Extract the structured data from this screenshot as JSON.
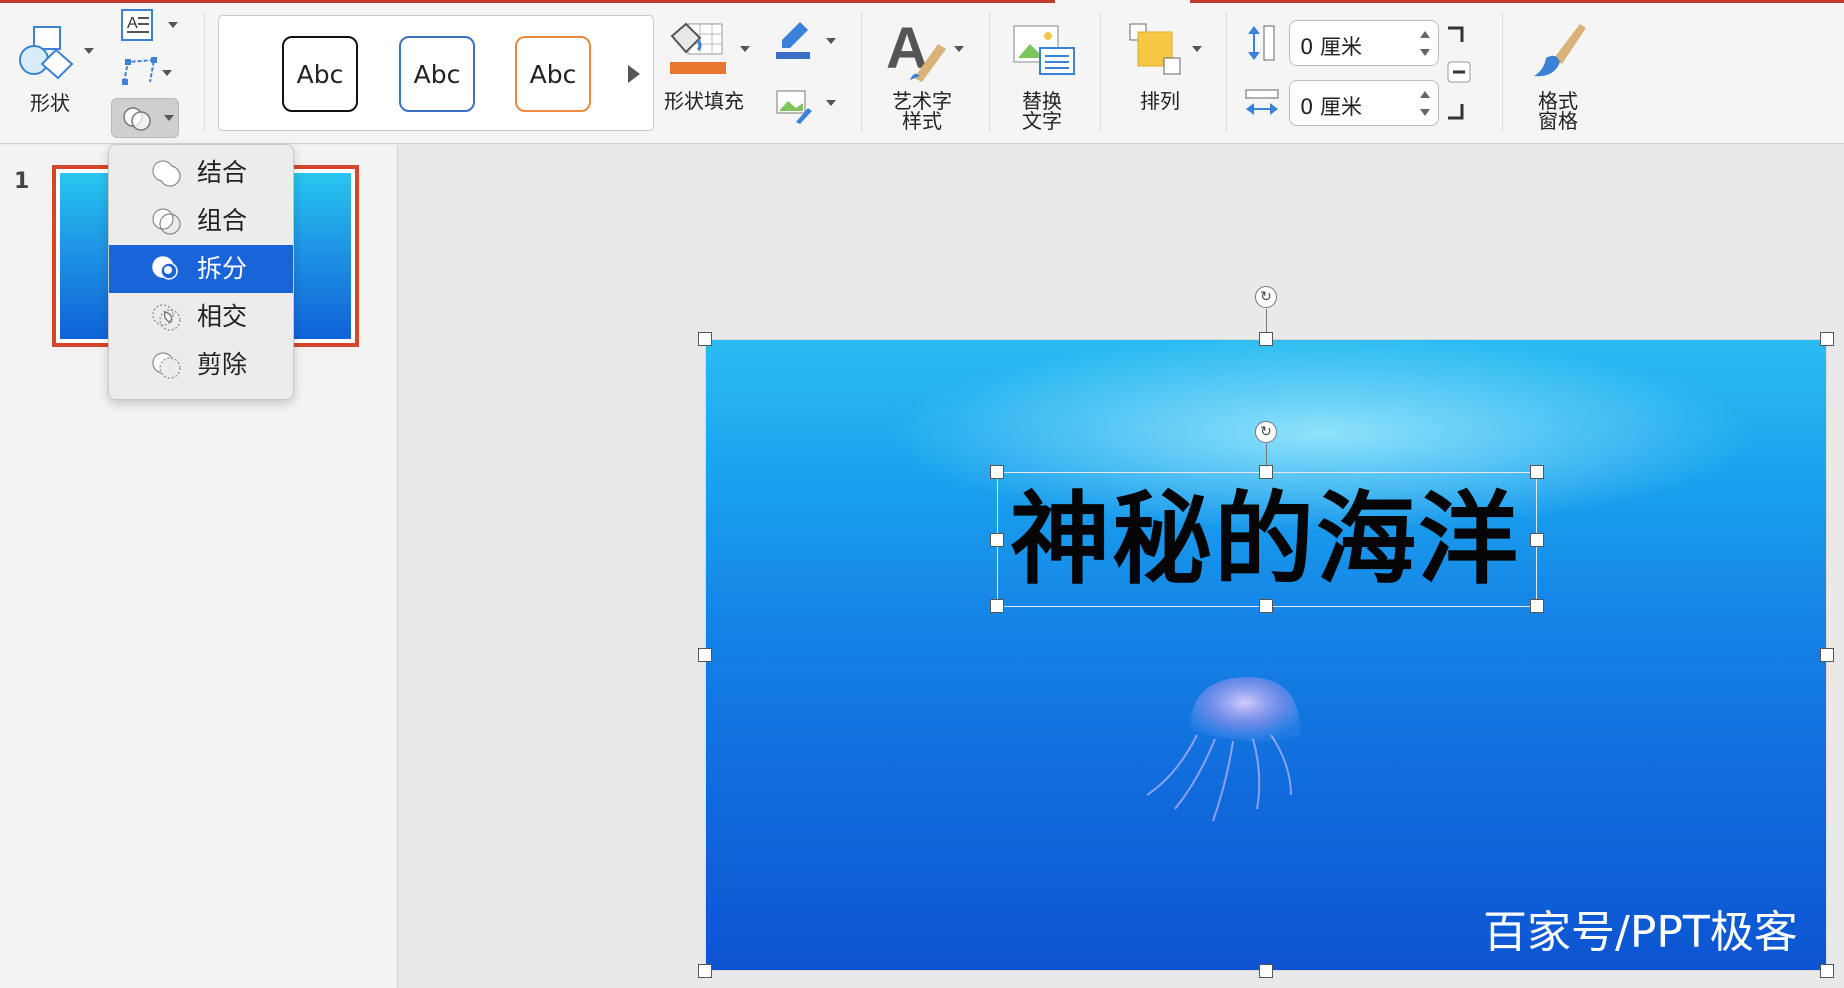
{
  "ribbon": {
    "shape_label": "形状",
    "shape_fill_label": "形状填充",
    "wordart_label_line1": "艺术字",
    "wordart_label_line2": "样式",
    "alt_text_line1": "替换",
    "alt_text_line2": "文字",
    "arrange_label": "排列",
    "format_pane_line1": "格式",
    "format_pane_line2": "窗格",
    "height_value": "0 厘米",
    "width_value": "0 厘米",
    "style_presets": [
      {
        "label": "Abc",
        "border": "#111111"
      },
      {
        "label": "Abc",
        "border": "#3d6fc4"
      },
      {
        "label": "Abc",
        "border": "#e98a3c"
      }
    ]
  },
  "merge_menu": {
    "items": [
      {
        "label": "结合",
        "icon": "union-icon",
        "selected": false
      },
      {
        "label": "组合",
        "icon": "combine-icon",
        "selected": false
      },
      {
        "label": "拆分",
        "icon": "fragment-icon",
        "selected": true
      },
      {
        "label": "相交",
        "icon": "intersect-icon",
        "selected": false
      },
      {
        "label": "剪除",
        "icon": "subtract-icon",
        "selected": false
      }
    ]
  },
  "thumbnails": {
    "slide_number": "1"
  },
  "slide": {
    "title": "神秘的海洋",
    "watermark": "百家号/PPT极客"
  },
  "colors": {
    "accent_red": "#c23a2b",
    "menu_highlight": "#1a64d9"
  }
}
